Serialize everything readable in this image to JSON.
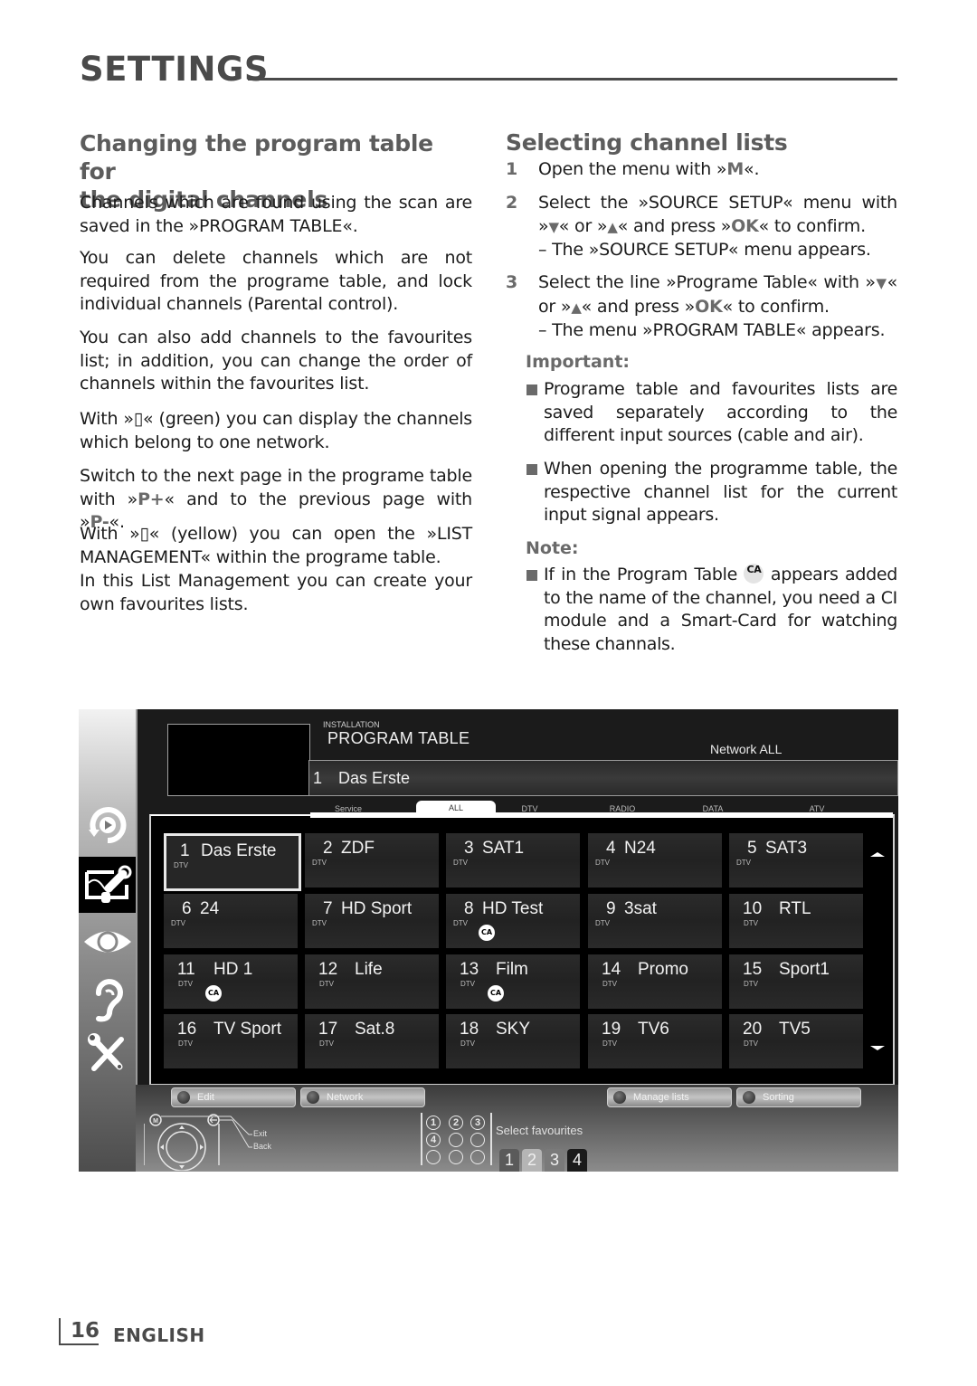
{
  "header": {
    "section_title": "SETTINGS"
  },
  "left": {
    "heading": "Changing the program table for the digital channels",
    "heading_line1": "Changing the program table for",
    "heading_line2": "the digital channels",
    "paragraphs": [
      "Channels which are found using the scan are saved in the »PROGRAM TABLE«.",
      "You can delete channels which are not required from the programe table, and lock individual channels (Parental control).",
      "You can also add channels to the favourites list; in addition, you can change the order of chan­nels within the favourites list.",
      "With »▯« (green) you can display the channels which belong to one network.",
      "Switch to the next page in the programe table with »P+« and to the previous page with »P-«.",
      "With »▯« (yellow) you can open the »LIST MANAGEMENT« within the programe table.",
      "In this List Management you can create your own favourites lists."
    ],
    "p5_a": "Switch to the next page in the programe table with »",
    "p5_key1": "P+",
    "p5_b": "« and to the previous page with »",
    "p5_key2": "P-",
    "p5_c": "«."
  },
  "right": {
    "heading": "Selecting channel lists",
    "steps": [
      {
        "num": "1",
        "a": "Open the menu with »",
        "key": "M",
        "b": "«."
      },
      {
        "num": "2",
        "a": "Select the »SOURCE SETUP« menu with »",
        "down": "▼",
        "m": "« or »",
        "up": "▲",
        "c": "« and press »",
        "key": "OK",
        "d": "« to confirm.",
        "sub": "– The »SOURCE SETUP« menu appears."
      },
      {
        "num": "3",
        "a": "Select the line »Programe Table« with »",
        "down": "▼",
        "m": "« or »",
        "up": "▲",
        "c": "« and press »",
        "key": "OK",
        "d": "« to confirm.",
        "sub": "– The menu »PROGRAM TABLE« appears."
      }
    ],
    "important_label": "Important:",
    "important_items": [
      "Programe table and favourites lists are saved separately according to the different input sources (cable and air).",
      "When opening the programme table, the respective channel list for the current input signal appears."
    ],
    "note_label": "Note:",
    "note_a": "If in the Program Table ",
    "note_ca": "CA",
    "note_b": " appears added to the name of the channel, you need a CI module and a Smart-Card for watching these channals."
  },
  "tv": {
    "breadcrumb": "INSTALLATION",
    "title": "PROGRAM TABLE",
    "network_filter": "Network ALL",
    "selected_channel": {
      "num": "1",
      "name": "Das Erste"
    },
    "tabs": [
      "Service",
      "ALL",
      "DTV",
      "RADIO",
      "DATA",
      "ATV"
    ],
    "active_tab": "ALL",
    "sidebar_icons": [
      "source-icon",
      "installation-icon",
      "picture-icon",
      "sound-icon",
      "tools-icon"
    ],
    "active_sidebar": "installation-icon",
    "channels": [
      {
        "num": "1",
        "name": "Das Erste",
        "type": "DTV",
        "ca": false,
        "selected": true
      },
      {
        "num": "2",
        "name": "ZDF",
        "type": "DTV",
        "ca": false
      },
      {
        "num": "3",
        "name": "SAT1",
        "type": "DTV",
        "ca": false
      },
      {
        "num": "4",
        "name": "N24",
        "type": "DTV",
        "ca": false
      },
      {
        "num": "5",
        "name": "SAT3",
        "type": "DTV",
        "ca": false
      },
      {
        "num": "6",
        "name": "24",
        "type": "DTV",
        "ca": false
      },
      {
        "num": "7",
        "name": "HD Sport",
        "type": "DTV",
        "ca": false
      },
      {
        "num": "8",
        "name": "HD Test",
        "type": "DTV",
        "ca": true
      },
      {
        "num": "9",
        "name": "3sat",
        "type": "DTV",
        "ca": false
      },
      {
        "num": "10",
        "name": "RTL",
        "type": "DTV",
        "ca": false
      },
      {
        "num": "11",
        "name": "HD 1",
        "type": "DTV",
        "ca": true
      },
      {
        "num": "12",
        "name": "Life",
        "type": "DTV",
        "ca": false
      },
      {
        "num": "13",
        "name": "Film",
        "type": "DTV",
        "ca": true
      },
      {
        "num": "14",
        "name": "Promo",
        "type": "DTV",
        "ca": false
      },
      {
        "num": "15",
        "name": "Sport1",
        "type": "DTV",
        "ca": false
      },
      {
        "num": "16",
        "name": "TV Sport",
        "type": "DTV",
        "ca": false
      },
      {
        "num": "17",
        "name": "Sat.8",
        "type": "DTV",
        "ca": false
      },
      {
        "num": "18",
        "name": "SKY",
        "type": "DTV",
        "ca": false
      },
      {
        "num": "19",
        "name": "TV6",
        "type": "DTV",
        "ca": false
      },
      {
        "num": "20",
        "name": "TV5",
        "type": "DTV",
        "ca": false
      }
    ],
    "ca_badge": "CA",
    "color_buttons": [
      "Edit",
      "Network",
      "Manage lists",
      "Sorting"
    ],
    "nav_hints": {
      "menu_key": "M",
      "exit": "Exit",
      "back": "Back"
    },
    "number_keys": [
      "1",
      "2",
      "3",
      "4"
    ],
    "favourites_label": "Select favourites",
    "favourite_lists": [
      "1",
      "2",
      "3",
      "4"
    ],
    "active_favourite": "4"
  },
  "footer": {
    "page_number": "16",
    "language": "ENGLISH"
  }
}
